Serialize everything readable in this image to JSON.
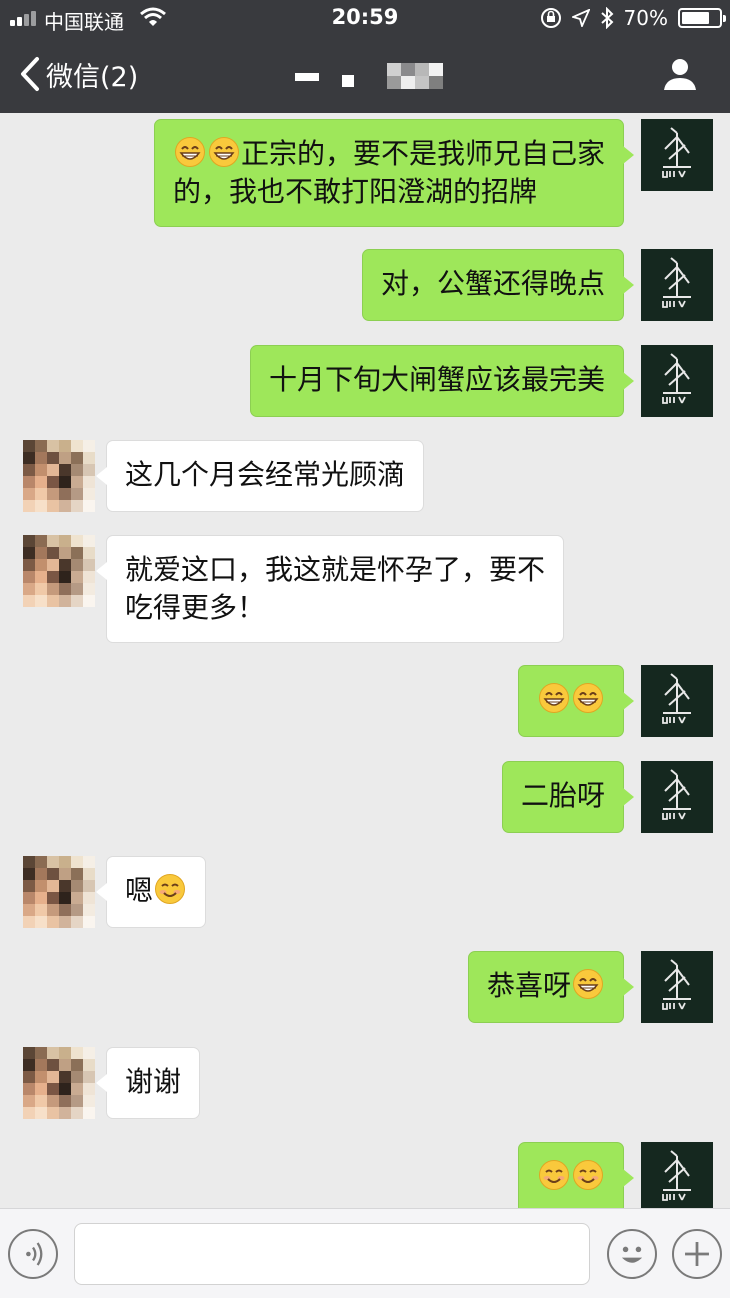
{
  "status_bar": {
    "carrier": "中国联通",
    "time": "20:59",
    "battery_percent": "70%"
  },
  "nav": {
    "back_label": "微信(2)",
    "contact_name_pixelated": true
  },
  "messages": [
    {
      "side": "me",
      "parts": [
        {
          "emoji": "grin"
        },
        {
          "emoji": "grin"
        },
        {
          "text": "正宗的，要不是我师兄自己家"
        },
        {
          "br": true
        },
        {
          "text": "的，我也不敢打阳澄湖的招牌"
        }
      ]
    },
    {
      "side": "me",
      "parts": [
        {
          "text": "对，公蟹还得晚点"
        }
      ]
    },
    {
      "side": "me",
      "parts": [
        {
          "text": "十月下旬大闸蟹应该最完美"
        }
      ]
    },
    {
      "side": "other",
      "parts": [
        {
          "text": "这几个月会经常光顾滴"
        }
      ]
    },
    {
      "side": "other",
      "parts": [
        {
          "text": "就爱这口，我这就是怀孕了，要不"
        },
        {
          "br": true
        },
        {
          "text": "吃得更多！"
        }
      ]
    },
    {
      "side": "me",
      "parts": [
        {
          "emoji": "grin"
        },
        {
          "emoji": "grin"
        }
      ]
    },
    {
      "side": "me",
      "parts": [
        {
          "text": "二胎呀"
        }
      ]
    },
    {
      "side": "other",
      "parts": [
        {
          "text": "嗯"
        },
        {
          "emoji": "smile"
        }
      ]
    },
    {
      "side": "me",
      "parts": [
        {
          "text": "恭喜呀"
        },
        {
          "emoji": "grin"
        }
      ]
    },
    {
      "side": "other",
      "parts": [
        {
          "text": "谢谢"
        }
      ]
    },
    {
      "side": "me",
      "parts": [
        {
          "emoji": "smile"
        },
        {
          "emoji": "smile"
        }
      ]
    }
  ],
  "colors": {
    "nav_bg": "#393a3e",
    "chat_bg": "#ebebeb",
    "bubble_me": "#9ee75a",
    "bubble_other": "#ffffff",
    "avatar_me_bg": "#15281f"
  },
  "icons": {
    "back": "chevron-left-icon",
    "profile": "person-icon",
    "voice": "voice-icon",
    "emoji": "emoji-icon",
    "more": "plus-icon"
  },
  "input": {
    "value": "",
    "placeholder": ""
  }
}
